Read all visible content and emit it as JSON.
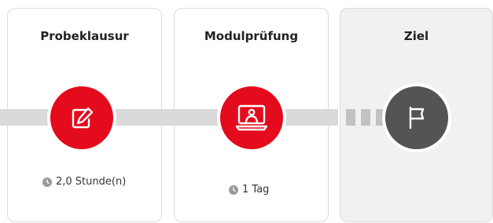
{
  "steps": [
    {
      "title": "Probeklausur",
      "duration": "2,0 Stunde(n)",
      "icon": "edit-icon"
    },
    {
      "title": "Modulprüfung",
      "duration": "1 Tag",
      "icon": "presentation-icon"
    },
    {
      "title": "Ziel",
      "icon": "flag-icon"
    }
  ],
  "colors": {
    "accent": "#e30b1c",
    "goal_node": "#545454",
    "track": "#dadada",
    "goal_card_bg": "#f1f1f1",
    "border": "#dcdcdc"
  }
}
